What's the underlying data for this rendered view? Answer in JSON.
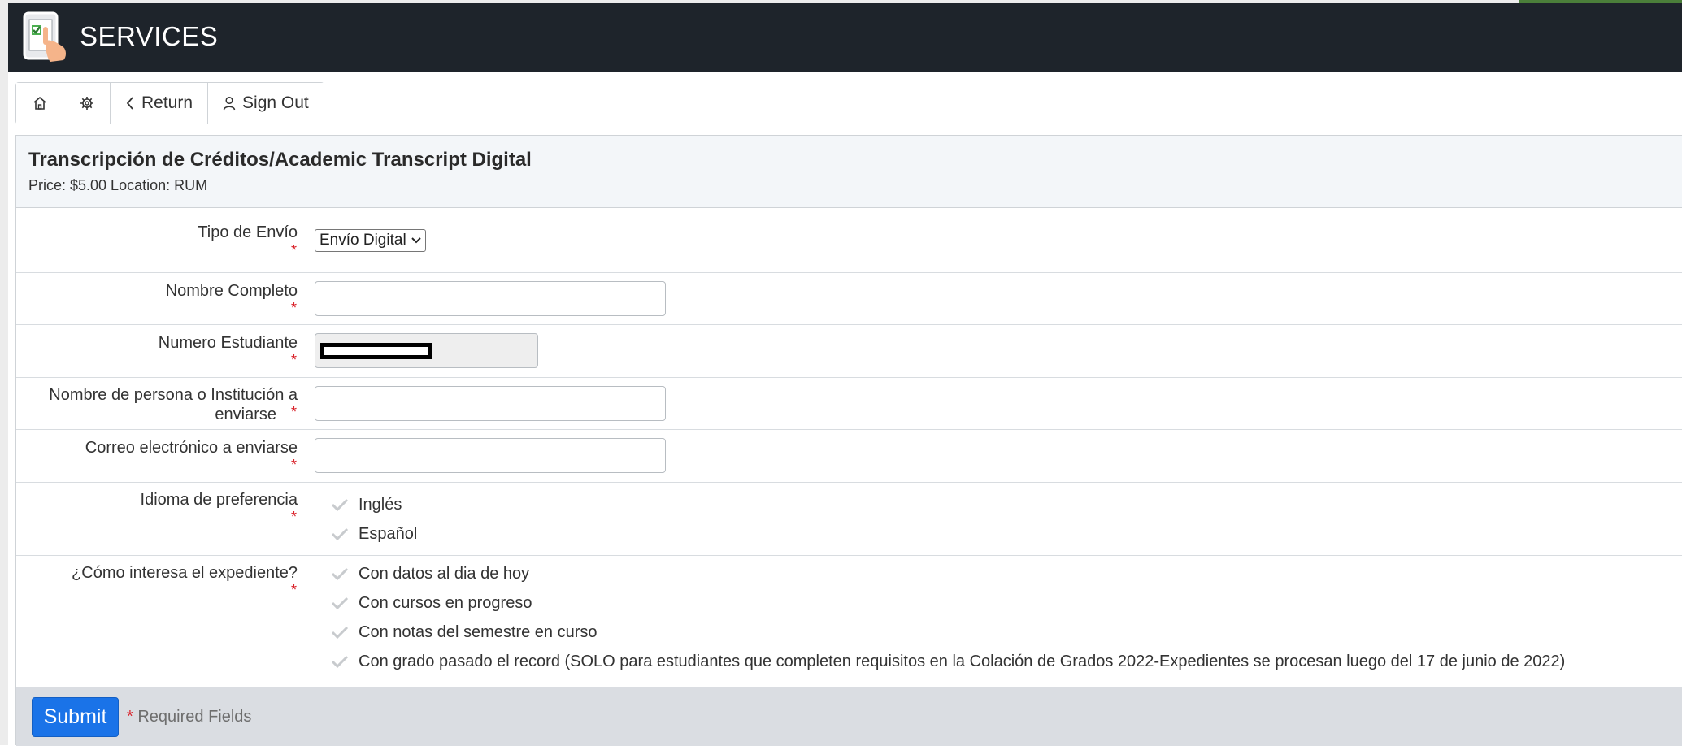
{
  "app": {
    "title": "SERVICES",
    "logo_icon": "tablet-checklist-logo"
  },
  "toolbar": {
    "home_icon": "home-icon",
    "settings_icon": "gear-icon",
    "return_label": "Return",
    "signout_label": "Sign Out"
  },
  "service": {
    "title": "Transcripción de Créditos/Academic Transcript Digital",
    "price_location": "Price: $5.00 Location: RUM"
  },
  "form": {
    "required_marker": "*",
    "tipo_envio": {
      "label": "Tipo de Envío",
      "selected": "Envío Digital"
    },
    "nombre_completo": {
      "label": "Nombre Completo",
      "value": ""
    },
    "numero_estudiante": {
      "label": "Numero Estudiante"
    },
    "institucion": {
      "label_line1": "Nombre de persona o Institución a",
      "label_line2": "enviarse",
      "value": ""
    },
    "correo": {
      "label": "Correo electrónico a enviarse",
      "value": ""
    },
    "idioma": {
      "label": "Idioma de preferencia",
      "options": [
        "Inglés",
        "Español"
      ]
    },
    "expediente": {
      "label": "¿Cómo interesa el expediente?",
      "options": [
        "Con datos al dia de hoy",
        "Con cursos en progreso",
        "Con notas del semestre en curso",
        "Con grado pasado el record (SOLO para estudiantes que completen requisitos en la Colación de Grados 2022-Expedientes se procesan luego del 17 de junio de 2022)"
      ]
    }
  },
  "footer": {
    "submit_label": "Submit",
    "required_star": "*",
    "required_note": "Required Fields"
  },
  "colors": {
    "header_bg": "#1e242b",
    "submit_bg": "#1a73e8",
    "required": "#d9222a",
    "footer_bg": "#dadde2"
  }
}
